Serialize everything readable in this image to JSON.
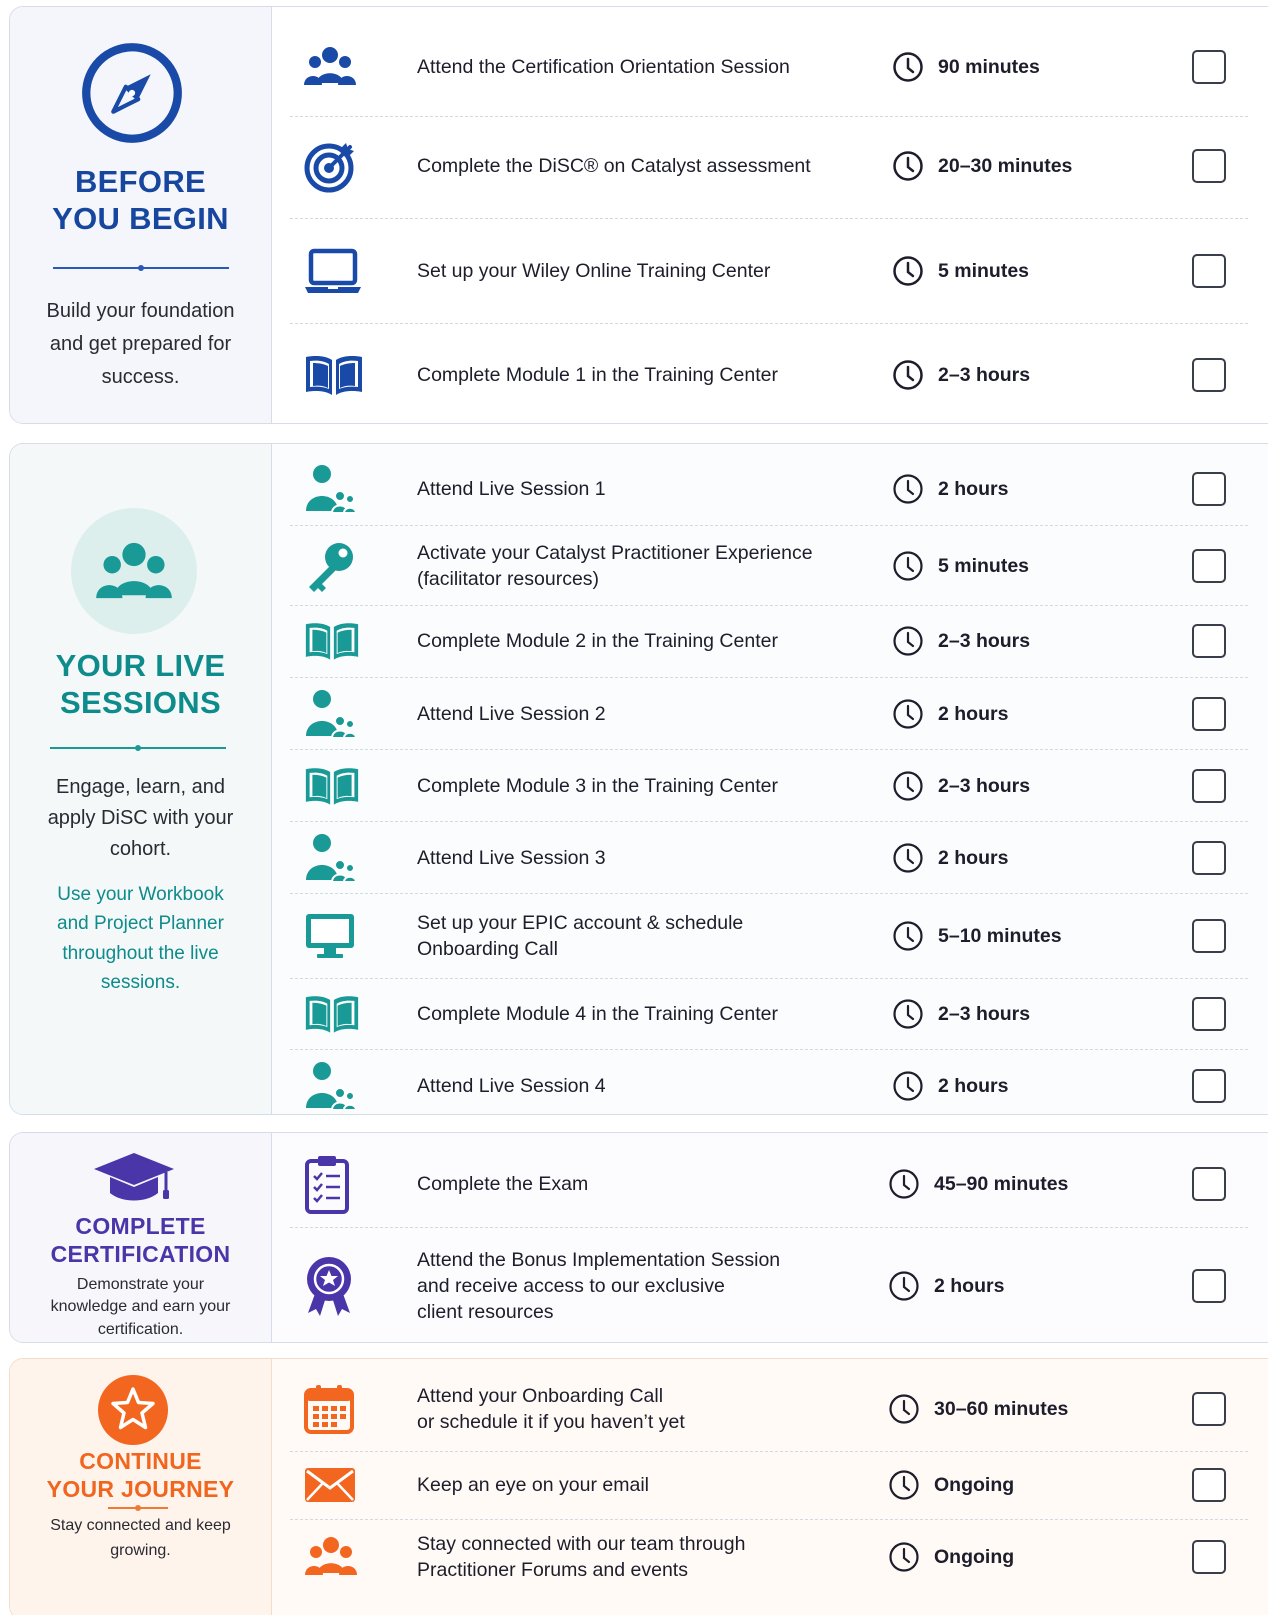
{
  "colors": {
    "before": "#17469e",
    "live": "#10918d",
    "certification": "#4a36a8",
    "journey": "#f0661f"
  },
  "sections": {
    "before": {
      "title_line1": "BEFORE",
      "title_line2": "YOU BEGIN",
      "desc": "Build your foundation and get prepared for success.",
      "icon": "compass-icon",
      "items": [
        {
          "icon": "group-icon",
          "label": "Attend the Certification Orientation Session",
          "time": "90 minutes"
        },
        {
          "icon": "target-icon",
          "label": "Complete the DiSC® on Catalyst assessment",
          "time": "20–30 minutes"
        },
        {
          "icon": "laptop-icon",
          "label": "Set up your Wiley Online Training Center",
          "time": "5 minutes"
        },
        {
          "icon": "book-icon",
          "label": "Complete Module 1 in the Training Center",
          "time": "2–3 hours"
        }
      ]
    },
    "live": {
      "title_line1": "YOUR LIVE",
      "title_line2": "SESSIONS",
      "desc": "Engage, learn, and apply DiSC with your cohort.",
      "note": "Use your Workbook and Project Planner throughout the live sessions.",
      "icon": "group-icon",
      "items": [
        {
          "icon": "presenter-icon",
          "label": "Attend Live Session 1",
          "time": "2 hours"
        },
        {
          "icon": "key-icon",
          "label_line1": "Activate your Catalyst Practitioner Experience",
          "label_line2": "(facilitator resources)",
          "time": "5 minutes"
        },
        {
          "icon": "book-icon",
          "label": "Complete Module 2 in the Training Center",
          "time": "2–3 hours"
        },
        {
          "icon": "presenter-icon",
          "label": "Attend Live Session 2",
          "time": "2 hours"
        },
        {
          "icon": "book-icon",
          "label": "Complete Module 3 in the Training Center",
          "time": "2–3 hours"
        },
        {
          "icon": "presenter-icon",
          "label": "Attend Live Session 3",
          "time": "2 hours"
        },
        {
          "icon": "monitor-icon",
          "label_line1": "Set up your EPIC account & schedule",
          "label_line2": "Onboarding Call",
          "time": "5–10 minutes"
        },
        {
          "icon": "book-icon",
          "label": "Complete Module 4 in the Training Center",
          "time": "2–3 hours"
        },
        {
          "icon": "presenter-icon",
          "label": "Attend Live Session 4",
          "time": "2 hours"
        }
      ]
    },
    "certification": {
      "title_line1": "COMPLETE",
      "title_line2": "CERTIFICATION",
      "desc": "Demonstrate your knowledge and earn your certification.",
      "icon": "graduation-cap-icon",
      "items": [
        {
          "icon": "clipboard-icon",
          "label": "Complete the Exam",
          "time": "45–90 minutes"
        },
        {
          "icon": "award-ribbon-icon",
          "label_line1": "Attend the Bonus Implementation Session",
          "label_line2": "and receive access to our exclusive",
          "label_line3": "client resources",
          "time": "2 hours"
        }
      ]
    },
    "journey": {
      "title_line1": "CONTINUE",
      "title_line2": "YOUR JOURNEY",
      "desc": "Stay connected and keep growing.",
      "icon": "star-icon",
      "items": [
        {
          "icon": "calendar-icon",
          "label_line1": "Attend your Onboarding Call",
          "label_line2": "or schedule it if you haven’t yet",
          "time": "30–60 minutes"
        },
        {
          "icon": "envelope-icon",
          "label": "Keep an eye on your email",
          "time": "Ongoing"
        },
        {
          "icon": "group-icon",
          "label_line1": "Stay connected with our team through",
          "label_line2": "Practitioner Forums and events",
          "time": "Ongoing"
        }
      ]
    }
  }
}
